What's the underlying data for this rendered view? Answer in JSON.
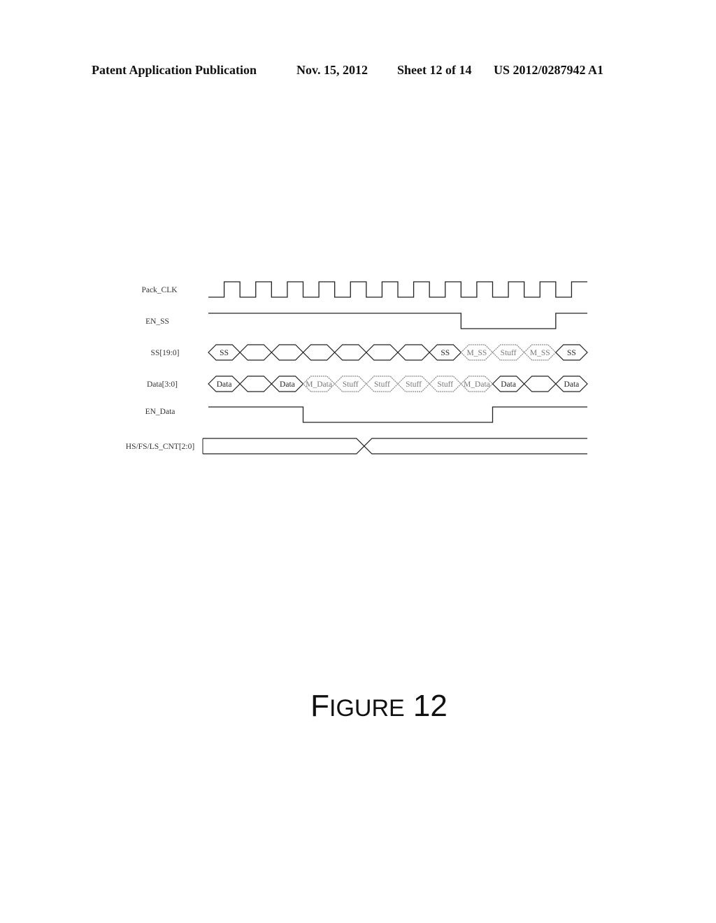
{
  "header": {
    "publication": "Patent Application Publication",
    "date": "Nov. 15, 2012",
    "sheet": "Sheet 12 of 14",
    "number": "US 2012/0287942 A1"
  },
  "figure": {
    "caption_first": "F",
    "caption_rest": "IGURE",
    "caption_number": "12"
  },
  "timing": {
    "cycles": 12,
    "signals": [
      {
        "name": "Pack_CLK",
        "type": "clock",
        "initial_level": "low",
        "half_period_edges": 24
      },
      {
        "name": "EN_SS",
        "type": "digital",
        "levels": [
          "high",
          "high",
          "high",
          "high",
          "high",
          "high",
          "high",
          "high",
          "low",
          "low",
          "low",
          "high"
        ]
      },
      {
        "name": "SS[19:0]",
        "type": "bus",
        "segments": [
          {
            "label": "SS",
            "style": "solid"
          },
          {
            "label": "",
            "style": "solid"
          },
          {
            "label": "",
            "style": "solid"
          },
          {
            "label": "",
            "style": "solid"
          },
          {
            "label": "",
            "style": "solid"
          },
          {
            "label": "",
            "style": "solid"
          },
          {
            "label": "",
            "style": "solid"
          },
          {
            "label": "SS",
            "style": "solid"
          },
          {
            "label": "M_SS",
            "style": "gray"
          },
          {
            "label": "Stuff",
            "style": "gray"
          },
          {
            "label": "M_SS",
            "style": "gray"
          },
          {
            "label": "SS",
            "style": "solid"
          }
        ]
      },
      {
        "name": "Data[3:0]",
        "type": "bus",
        "segments": [
          {
            "label": "Data",
            "style": "solid"
          },
          {
            "label": "",
            "style": "solid"
          },
          {
            "label": "Data",
            "style": "solid"
          },
          {
            "label": "M_Data",
            "style": "gray"
          },
          {
            "label": "Stuff",
            "style": "gray"
          },
          {
            "label": "Stuff",
            "style": "gray"
          },
          {
            "label": "Stuff",
            "style": "gray"
          },
          {
            "label": "Stuff",
            "style": "gray"
          },
          {
            "label": "M_Data",
            "style": "gray"
          },
          {
            "label": "Data",
            "style": "solid"
          },
          {
            "label": "",
            "style": "solid"
          },
          {
            "label": "Data",
            "style": "solid"
          }
        ]
      },
      {
        "name": "EN_Data",
        "type": "digital",
        "levels": [
          "high",
          "high",
          "high",
          "low",
          "low",
          "low",
          "low",
          "low",
          "low",
          "high",
          "high",
          "high"
        ]
      },
      {
        "name": "HS/FS/LS_CNT[2:0]",
        "type": "counter",
        "transition_at_cycle": 5
      }
    ]
  }
}
